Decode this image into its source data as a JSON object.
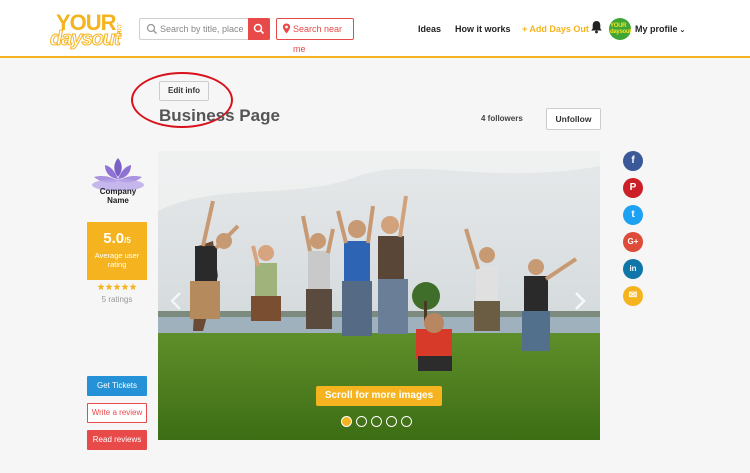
{
  "header": {
    "logo": {
      "line1": "YOUR",
      "line2": "daysout",
      "suffix": ".com"
    },
    "search": {
      "placeholder": "Search by title, place"
    },
    "near_label": "Search near me",
    "nav": {
      "ideas": "Ideas",
      "how_it_works": "How it works",
      "add_days_out": "+ Add Days Out"
    },
    "avatar_text": "YOUR daysout",
    "profile_label": "My profile",
    "profile_chevron": "⌄"
  },
  "business": {
    "edit_label": "Edit info",
    "title": "Business Page",
    "followers": "4 followers",
    "unfollow_label": "Unfollow"
  },
  "company": {
    "name": "Company Name",
    "rating": {
      "score": "5.0",
      "out_of": "/5",
      "label": "Average user rating",
      "stars": 5,
      "count_label": "5 ratings"
    }
  },
  "actions": {
    "get_tickets": "Get Tickets",
    "write_review": "Write a review",
    "read_reviews": "Read reviews"
  },
  "gallery": {
    "scroll_label": "Scroll for more images",
    "slide_count": 5,
    "active_index": 0
  },
  "social": [
    {
      "name": "facebook",
      "glyph": "f",
      "color": "#3b5998"
    },
    {
      "name": "pinterest",
      "glyph": "P",
      "color": "#cb2027"
    },
    {
      "name": "twitter",
      "glyph": "t",
      "color": "#1da1f2"
    },
    {
      "name": "google-plus",
      "glyph": "G+",
      "color": "#dd4b39"
    },
    {
      "name": "linkedin",
      "glyph": "in",
      "color": "#0e76a8"
    },
    {
      "name": "email",
      "glyph": "✉",
      "color": "#f5b41f"
    }
  ],
  "colors": {
    "accent": "#f5b41f",
    "red": "#e84a4a",
    "blue": "#2592d8",
    "highlight": "#d8121b"
  }
}
